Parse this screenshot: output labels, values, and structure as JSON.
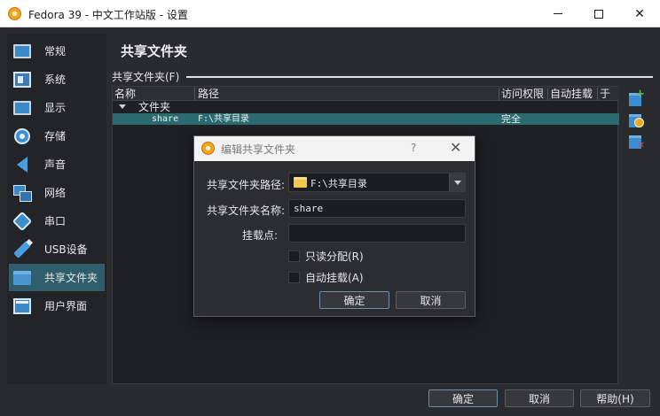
{
  "window": {
    "title": "Fedora 39 - 中文工作站版 - 设置",
    "controls": [
      "minimize",
      "maximize",
      "close"
    ]
  },
  "sidebar": {
    "items": [
      {
        "label": "常规",
        "icon": "monitor-icon"
      },
      {
        "label": "系统",
        "icon": "motherboard-icon"
      },
      {
        "label": "显示",
        "icon": "display-icon"
      },
      {
        "label": "存储",
        "icon": "disk-icon"
      },
      {
        "label": "声音",
        "icon": "speaker-icon"
      },
      {
        "label": "网络",
        "icon": "network-icon"
      },
      {
        "label": "串口",
        "icon": "serial-port-icon"
      },
      {
        "label": "USB设备",
        "icon": "usb-icon"
      },
      {
        "label": "共享文件夹",
        "icon": "shared-folder-icon",
        "selected": true
      },
      {
        "label": "用户界面",
        "icon": "user-interface-icon"
      }
    ]
  },
  "main": {
    "title": "共享文件夹",
    "group_label": "共享文件夹(F)",
    "table": {
      "columns": [
        "名称",
        "路径",
        "访问权限",
        "自动挂载",
        "于"
      ],
      "group": "文件夹",
      "rows": [
        {
          "name": "share",
          "path": "F:\\共享目录",
          "access": "完全",
          "auto_mount": "",
          "at": ""
        }
      ]
    }
  },
  "dialog": {
    "title": "编辑共享文件夹",
    "help": "?",
    "path_label": "共享文件夹路径:",
    "path_value": "F:\\共享目录",
    "name_label": "共享文件夹名称:",
    "name_value": "share",
    "mount_label": "挂载点:",
    "mount_value": "",
    "readonly_label": "只读分配(R)",
    "readonly_checked": false,
    "automount_label": "自动挂载(A)",
    "automount_checked": false,
    "ok": "确定",
    "cancel": "取消"
  },
  "footer": {
    "ok": "确定",
    "cancel": "取消",
    "help": "帮助(H)"
  },
  "colors": {
    "background": "#2a2b2f",
    "selection": "#2f5d6b",
    "row_selection": "#2b6a6f"
  }
}
